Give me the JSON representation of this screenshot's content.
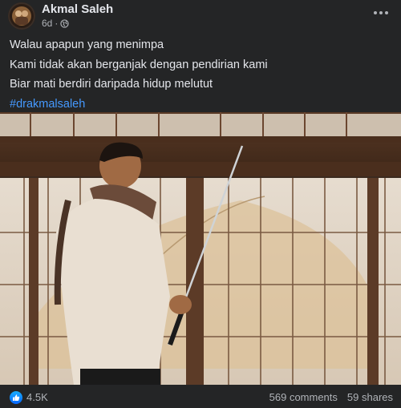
{
  "post": {
    "author": "Akmal Saleh",
    "time": "6d",
    "separator": "·",
    "lines": [
      "Walau apapun yang menimpa",
      "Kami tidak akan berganjak dengan pendirian kami",
      "Biar mati berdiri daripada hidup melutut"
    ],
    "hashtag": "#drakmalsaleh"
  },
  "reactions": {
    "count": "4.5K",
    "comments": "569 comments",
    "shares": "59 shares"
  },
  "icons": {
    "privacy": "globe-icon",
    "menu": "more-options-icon",
    "reaction": "like-icon"
  },
  "colors": {
    "background": "#242526",
    "text": "#e4e6eb",
    "secondary_text": "#b0b3b8",
    "hashtag": "#4599ff",
    "like_blue": "#0866ff"
  }
}
